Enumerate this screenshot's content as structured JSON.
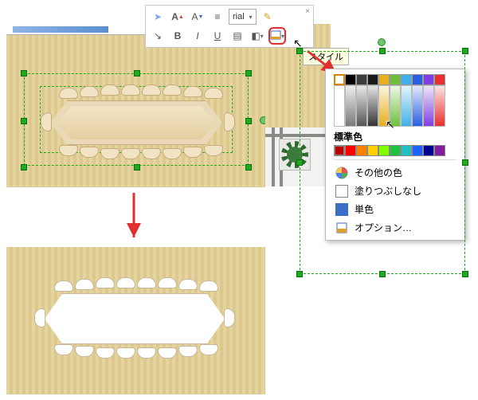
{
  "toolbar": {
    "font_display": "rial",
    "buttons": {
      "pointer": "pointer-icon",
      "font_big": "A▲",
      "font_small": "A▼",
      "line_style": "≡",
      "highlighter": "highlighter-icon",
      "connector": "connector-icon",
      "bold": "B",
      "italic": "I",
      "underline": "U",
      "align": "align-icon",
      "effects": "effects-icon",
      "fill": "fill-icon",
      "fill_dd": "▾"
    }
  },
  "tooltip": {
    "style_label": "スタイル"
  },
  "color_popup": {
    "theme_row": [
      "#ffffff",
      "#000000",
      "#3b3b3b",
      "#1a1a1a",
      "#e8b020",
      "#6fbf3f",
      "#3fb0e8",
      "#2a5fe0",
      "#803fe0",
      "#e83030"
    ],
    "gradients": [
      "#ffffff",
      "#7a7a7a",
      "#555555",
      "#333333",
      "#e8b020",
      "#6fbf3f",
      "#3fb0e8",
      "#2a5fe0",
      "#803fe0",
      "#e83030"
    ],
    "standard_label": "標準色",
    "standard_row": [
      "#c00000",
      "#ff0000",
      "#ff8000",
      "#ffd000",
      "#80ff00",
      "#20c040",
      "#20c0c0",
      "#2060ff",
      "#000090",
      "#8020a0"
    ],
    "more_colors": "その他の色",
    "no_fill": "塗りつぶしなし",
    "solid_fill": "単色",
    "options": "オプション…"
  }
}
